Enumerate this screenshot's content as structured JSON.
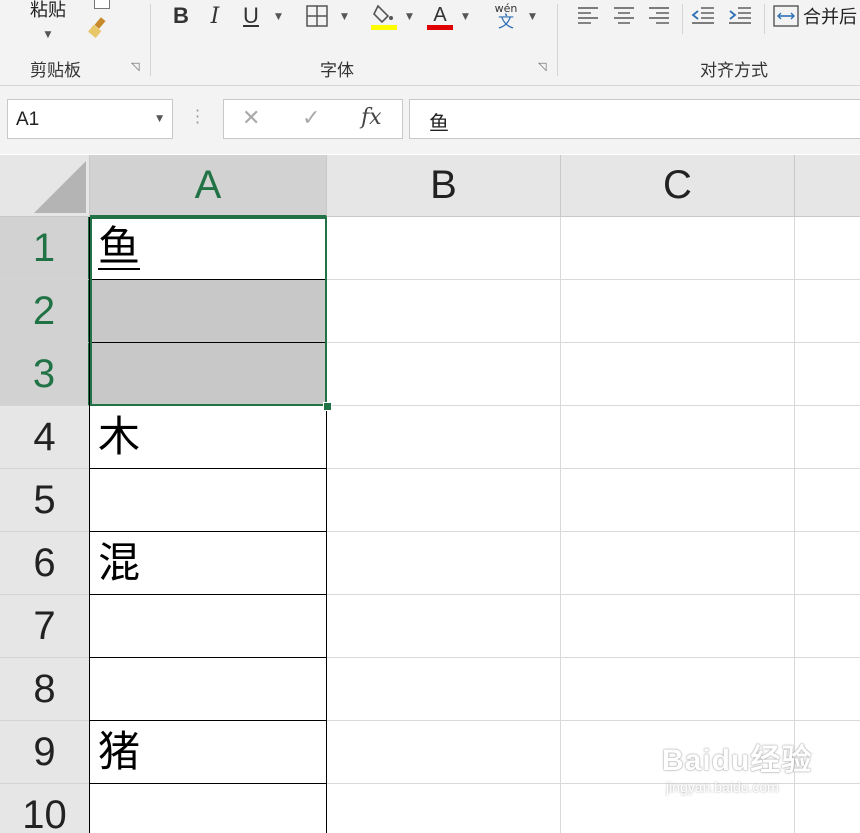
{
  "ribbon": {
    "clipboard": {
      "paste_label": "粘贴",
      "group_label": "剪贴板"
    },
    "font": {
      "group_label": "字体",
      "bold": "B",
      "italic": "I",
      "underline": "U",
      "phonetic_top": "wén",
      "phonetic_bottom": "文",
      "fill_color": "#ffff00",
      "font_color": "#e00000"
    },
    "alignment": {
      "group_label": "对齐方式",
      "merge_label": "合并后"
    }
  },
  "formula_bar": {
    "name_box": "A1",
    "cancel_glyph": "✕",
    "enter_glyph": "✓",
    "fx_glyph": "fx",
    "content": "鱼"
  },
  "sheet": {
    "columns": [
      "A",
      "B",
      "C"
    ],
    "rows": [
      "1",
      "2",
      "3",
      "4",
      "5",
      "6",
      "7",
      "8",
      "9",
      "10"
    ],
    "cells_A": [
      "鱼",
      "",
      "",
      "木",
      "",
      "混",
      "",
      "",
      "猪",
      ""
    ],
    "selection": "A1:A3",
    "accent_color": "#217346"
  },
  "watermark": {
    "brand": "Baidu经验",
    "url": "jingyan.baidu.com"
  }
}
